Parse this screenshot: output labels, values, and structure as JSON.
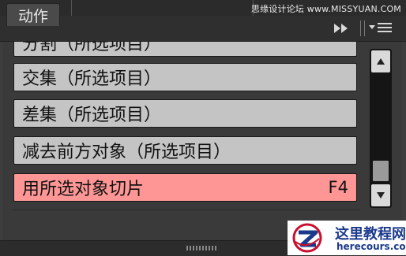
{
  "watermark_top": "思缘设计论坛 www.MISSYUAN.COM",
  "panel": {
    "tab_label": "动作"
  },
  "items": [
    {
      "label": "分割（所选项目）",
      "shortcut": ""
    },
    {
      "label": "交集（所选项目）",
      "shortcut": ""
    },
    {
      "label": "差集（所选项目）",
      "shortcut": ""
    },
    {
      "label": "减去前方对象（所选项目）",
      "shortcut": ""
    },
    {
      "label": "用所选对象切片",
      "shortcut": "F4"
    }
  ],
  "logo": {
    "title": "这里教程网",
    "subtitle": "herecours.com"
  },
  "colors": {
    "item_bg": "#c4c4c4",
    "selected_bg": "#ff9696",
    "panel_bg": "#3a3a3a"
  },
  "icons": [
    "fast-forward-icon",
    "panel-menu-icon",
    "scroll-up-icon",
    "scroll-down-icon",
    "resize-grip-icon",
    "site-logo-icon"
  ]
}
